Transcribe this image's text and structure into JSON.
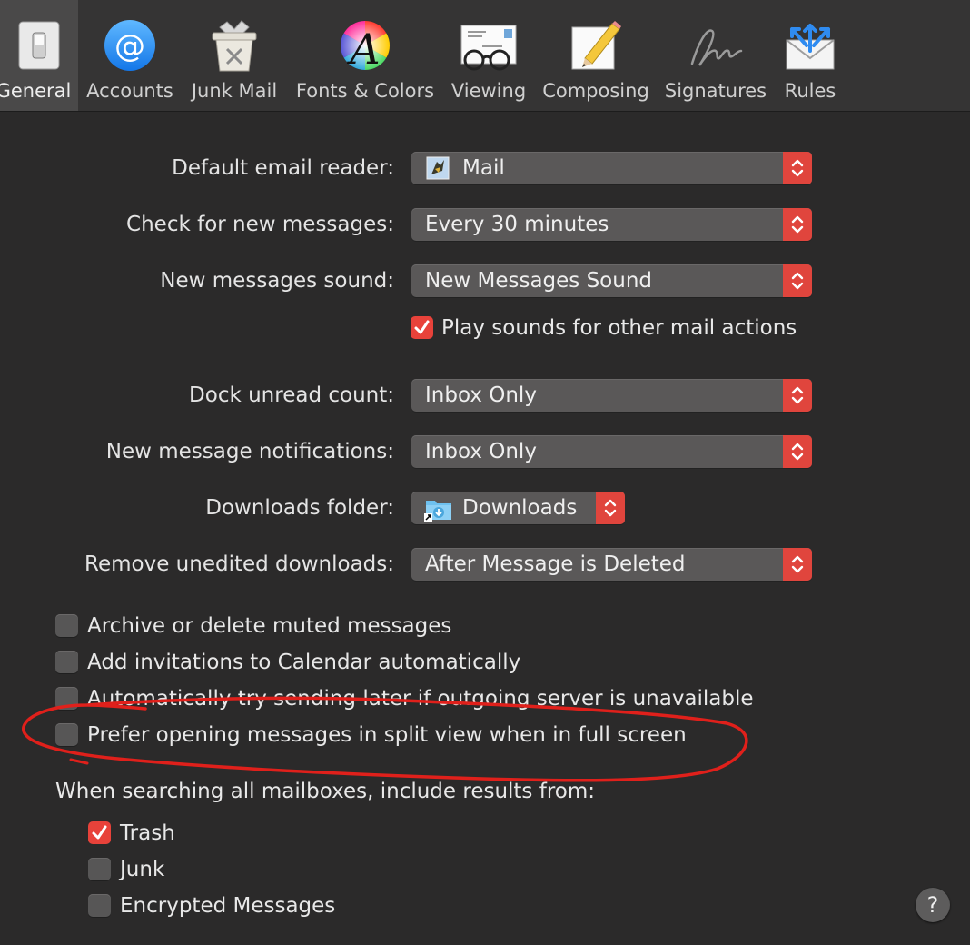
{
  "toolbar": {
    "items": [
      {
        "label": "General",
        "icon": "general-switch-icon",
        "active": true
      },
      {
        "label": "Accounts",
        "icon": "at-sign-icon"
      },
      {
        "label": "Junk Mail",
        "icon": "junk-bin-icon"
      },
      {
        "label": "Fonts & Colors",
        "icon": "color-wheel-font-icon"
      },
      {
        "label": "Viewing",
        "icon": "glasses-letter-icon"
      },
      {
        "label": "Composing",
        "icon": "pencil-paper-icon"
      },
      {
        "label": "Signatures",
        "icon": "signature-icon"
      },
      {
        "label": "Rules",
        "icon": "envelope-arrows-icon"
      }
    ]
  },
  "settings": {
    "default_reader": {
      "label": "Default email reader:",
      "value": "Mail"
    },
    "check_new": {
      "label": "Check for new messages:",
      "value": "Every 30 minutes"
    },
    "new_sound": {
      "label": "New messages sound:",
      "value": "New Messages Sound"
    },
    "play_sounds": {
      "label": "Play sounds for other mail actions",
      "checked": true
    },
    "dock_unread": {
      "label": "Dock unread count:",
      "value": "Inbox Only"
    },
    "notifications": {
      "label": "New message notifications:",
      "value": "Inbox Only"
    },
    "downloads_folder": {
      "label": "Downloads folder:",
      "value": "Downloads"
    },
    "remove_downloads": {
      "label": "Remove unedited downloads:",
      "value": "After Message is Deleted"
    }
  },
  "options": [
    {
      "label": "Archive or delete muted messages",
      "checked": false
    },
    {
      "label": "Add invitations to Calendar automatically",
      "checked": false
    },
    {
      "label": "Automatically try sending later if outgoing server is unavailable",
      "checked": false
    },
    {
      "label": "Prefer opening messages in split view when in full screen",
      "checked": false
    }
  ],
  "search": {
    "heading": "When searching all mailboxes, include results from:",
    "items": [
      {
        "label": "Trash",
        "checked": true
      },
      {
        "label": "Junk",
        "checked": false
      },
      {
        "label": "Encrypted Messages",
        "checked": false
      }
    ]
  },
  "help_glyph": "?",
  "colors": {
    "accent": "#e8423a",
    "background": "#2b2a2a",
    "toolbar": "#353434",
    "annotation": "#e0201b"
  }
}
